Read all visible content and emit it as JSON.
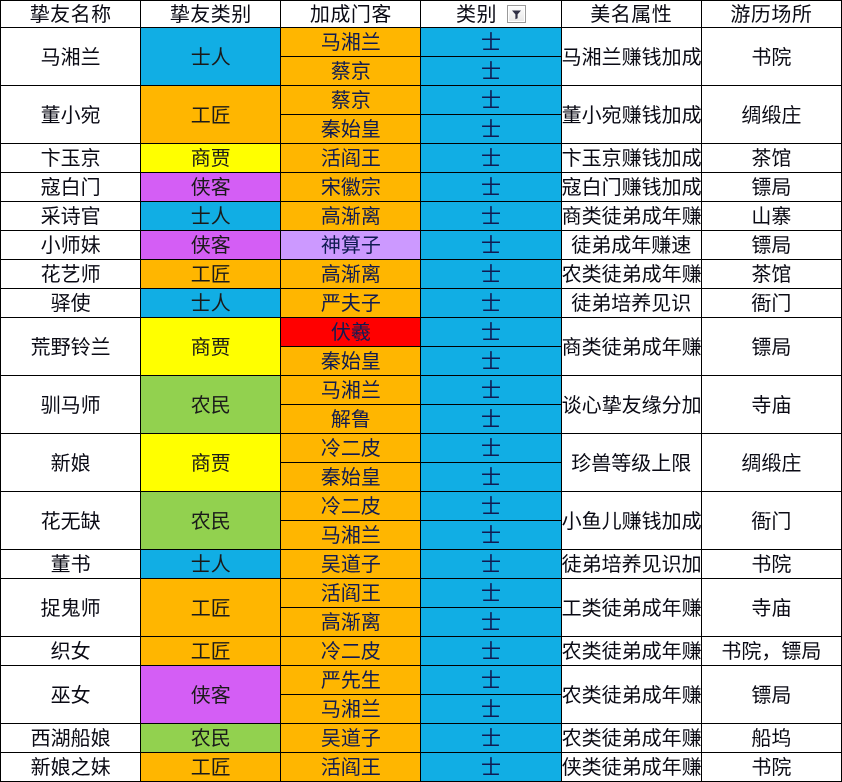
{
  "header": {
    "columns": [
      {
        "key": "name",
        "label": "挚友名称"
      },
      {
        "key": "category",
        "label": "挚友类别"
      },
      {
        "key": "retainer",
        "label": "加成门客"
      },
      {
        "key": "type",
        "label": "类别",
        "filter": true
      },
      {
        "key": "attribute",
        "label": "美名属性"
      },
      {
        "key": "place",
        "label": "游历场所"
      }
    ],
    "filter_icon": "filter-funnel-icon"
  },
  "palette": {
    "blue": "#11AEE4",
    "orange": "#FFB600",
    "yellow": "#FFFF00",
    "purple": "#D45EF5",
    "green": "#92D14F",
    "light_purple": "#CC99FF",
    "red": "#FF0000",
    "white": "#FFFFFF"
  },
  "rows": [
    {
      "name": "马湘兰",
      "category": "士人",
      "category_color": "blue",
      "retainers": [
        {
          "text": "马湘兰",
          "color": "orange"
        },
        {
          "text": "蔡京",
          "color": "orange"
        }
      ],
      "types": [
        "士",
        "士"
      ],
      "attribute": "马湘兰赚钱加成",
      "place": "书院",
      "group_start": true
    },
    {
      "name": "董小宛",
      "category": "工匠",
      "category_color": "orange",
      "retainers": [
        {
          "text": "蔡京",
          "color": "orange"
        },
        {
          "text": "秦始皇",
          "color": "orange"
        }
      ],
      "types": [
        "士",
        "士"
      ],
      "attribute": "董小宛赚钱加成",
      "place": "绸缎庄",
      "group_start": false
    },
    {
      "name": "卞玉京",
      "category": "商贾",
      "category_color": "yellow",
      "retainers": [
        {
          "text": "活阎王",
          "color": "orange"
        }
      ],
      "types": [
        "士"
      ],
      "attribute": "卞玉京赚钱加成",
      "place": "茶馆",
      "group_start": true
    },
    {
      "name": "寇白门",
      "category": "侠客",
      "category_color": "purple",
      "retainers": [
        {
          "text": "宋徽宗",
          "color": "orange"
        }
      ],
      "types": [
        "士"
      ],
      "attribute": "寇白门赚钱加成",
      "place": "镖局",
      "group_start": false
    },
    {
      "name": "采诗官",
      "category": "士人",
      "category_color": "blue",
      "retainers": [
        {
          "text": "高渐离",
          "color": "orange"
        }
      ],
      "types": [
        "士"
      ],
      "attribute": "商类徒弟成年赚速",
      "place": "山寨",
      "group_start": true
    },
    {
      "name": "小师妹",
      "category": "侠客",
      "category_color": "purple",
      "retainers": [
        {
          "text": "神算子",
          "color": "light_purple"
        }
      ],
      "types": [
        "士"
      ],
      "attribute": "徒弟成年赚速",
      "place": "镖局",
      "group_start": false
    },
    {
      "name": "花艺师",
      "category": "工匠",
      "category_color": "orange",
      "retainers": [
        {
          "text": "高渐离",
          "color": "orange"
        }
      ],
      "types": [
        "士"
      ],
      "attribute": "农类徒弟成年赚速",
      "place": "茶馆",
      "group_start": false
    },
    {
      "name": "驿使",
      "category": "士人",
      "category_color": "blue",
      "retainers": [
        {
          "text": "严夫子",
          "color": "orange"
        }
      ],
      "types": [
        "士"
      ],
      "attribute": "徒弟培养见识",
      "place": "衙门",
      "group_start": true
    },
    {
      "name": "荒野铃兰",
      "category": "商贾",
      "category_color": "yellow",
      "retainers": [
        {
          "text": "伏羲",
          "color": "red"
        },
        {
          "text": "秦始皇",
          "color": "orange"
        }
      ],
      "types": [
        "士",
        "士"
      ],
      "attribute": "商类徒弟成年赚速",
      "place": "镖局",
      "group_start": true
    },
    {
      "name": "驯马师",
      "category": "农民",
      "category_color": "green",
      "retainers": [
        {
          "text": "马湘兰",
          "color": "orange"
        },
        {
          "text": "解鲁",
          "color": "orange"
        }
      ],
      "types": [
        "士",
        "士"
      ],
      "attribute": "谈心挚友缘分加成",
      "place": "寺庙",
      "group_start": true
    },
    {
      "name": "新娘",
      "category": "商贾",
      "category_color": "yellow",
      "retainers": [
        {
          "text": "冷二皮",
          "color": "orange"
        },
        {
          "text": "秦始皇",
          "color": "orange"
        }
      ],
      "types": [
        "士",
        "士"
      ],
      "attribute": "珍兽等级上限",
      "place": "绸缎庄",
      "group_start": true
    },
    {
      "name": "花无缺",
      "category": "农民",
      "category_color": "green",
      "retainers": [
        {
          "text": "冷二皮",
          "color": "orange"
        },
        {
          "text": "马湘兰",
          "color": "orange"
        }
      ],
      "types": [
        "士",
        "士"
      ],
      "attribute": "小鱼儿赚钱加成",
      "place": "衙门",
      "group_start": true
    },
    {
      "name": "董书",
      "category": "士人",
      "category_color": "blue",
      "retainers": [
        {
          "text": "吴道子",
          "color": "orange"
        }
      ],
      "types": [
        "士"
      ],
      "attribute": "徒弟培养见识加成",
      "place": "书院",
      "group_start": true
    },
    {
      "name": "捉鬼师",
      "category": "工匠",
      "category_color": "orange",
      "retainers": [
        {
          "text": "活阎王",
          "color": "orange"
        },
        {
          "text": "高渐离",
          "color": "orange"
        }
      ],
      "types": [
        "士",
        "士"
      ],
      "attribute": "工类徒弟成年赚速",
      "place": "寺庙",
      "group_start": true
    },
    {
      "name": "织女",
      "category": "工匠",
      "category_color": "orange",
      "retainers": [
        {
          "text": "冷二皮",
          "color": "orange"
        }
      ],
      "types": [
        "士"
      ],
      "attribute": "农类徒弟成年赚速",
      "place": "书院，镖局",
      "group_start": true
    },
    {
      "name": "巫女",
      "category": "侠客",
      "category_color": "purple",
      "retainers": [
        {
          "text": "严先生",
          "color": "orange"
        },
        {
          "text": "马湘兰",
          "color": "orange"
        }
      ],
      "types": [
        "士",
        "士"
      ],
      "attribute": "农类徒弟成年赚速",
      "place": "镖局",
      "group_start": true
    },
    {
      "name": "西湖船娘",
      "category": "农民",
      "category_color": "green",
      "retainers": [
        {
          "text": "吴道子",
          "color": "orange"
        }
      ],
      "types": [
        "士"
      ],
      "attribute": "农类徒弟成年赚速",
      "place": "船坞",
      "group_start": true
    },
    {
      "name": "新娘之妹",
      "category": "工匠",
      "category_color": "orange",
      "retainers": [
        {
          "text": "活阎王",
          "color": "orange"
        }
      ],
      "types": [
        "士"
      ],
      "attribute": "侠类徒弟成年赚速",
      "place": "书院",
      "group_start": false
    }
  ]
}
